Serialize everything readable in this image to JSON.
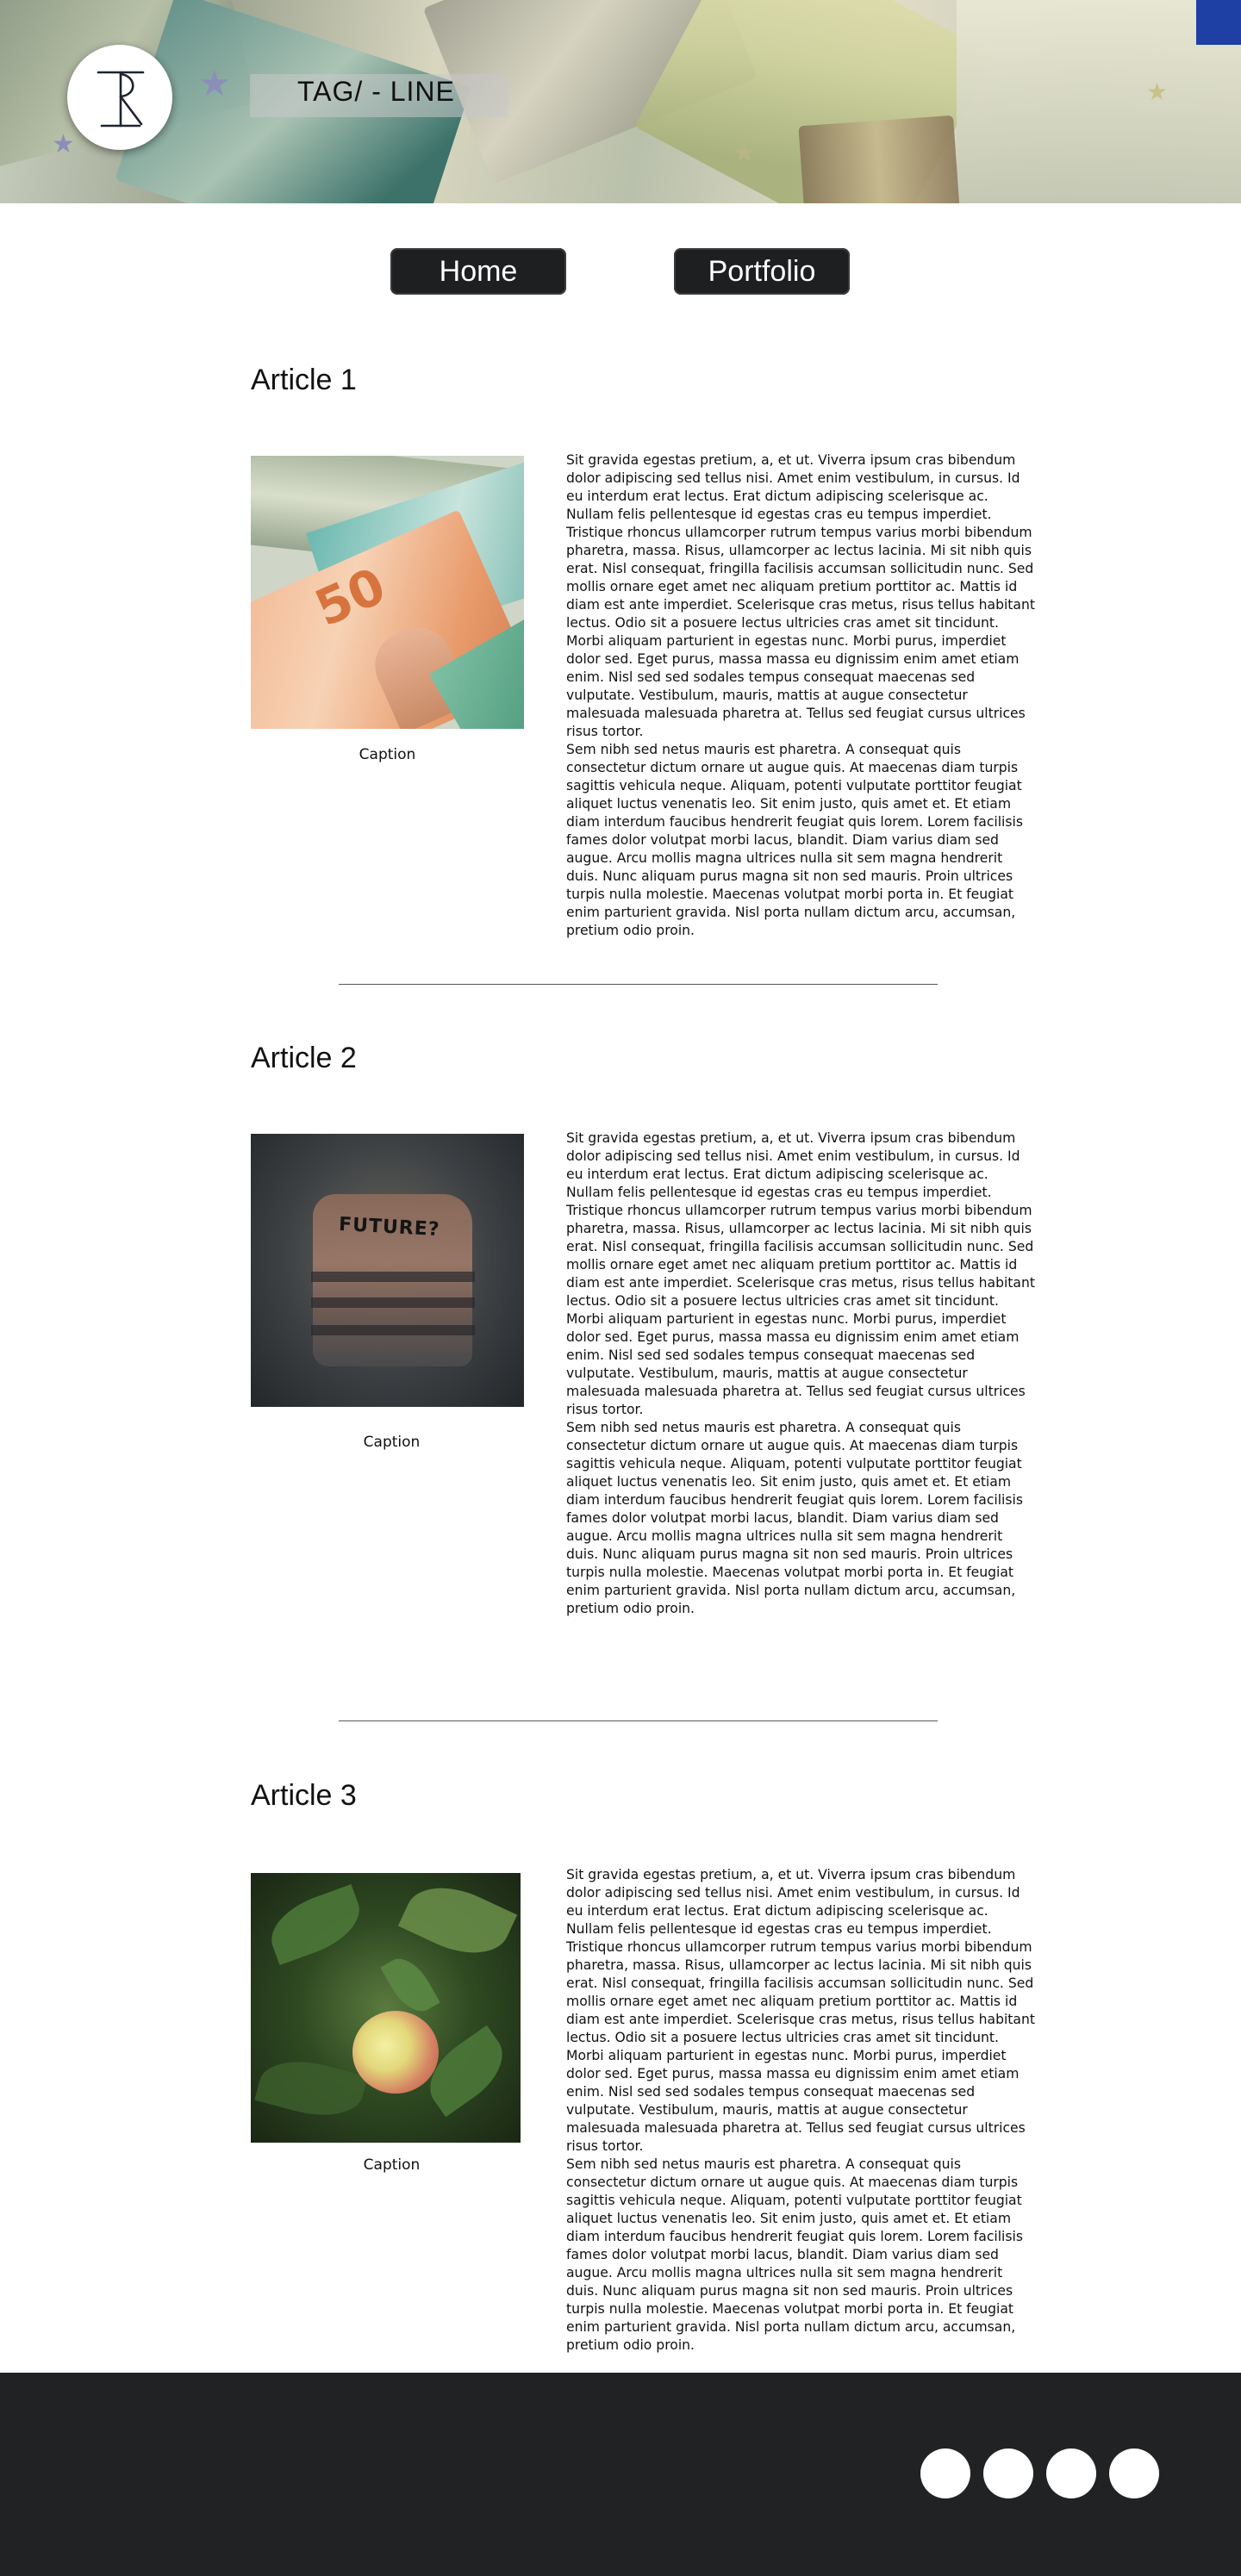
{
  "header": {
    "tagline": "TAG/ - LINE"
  },
  "nav": {
    "home_label": "Home",
    "portfolio_label": "Portfolio"
  },
  "articles": [
    {
      "title": "Article 1",
      "caption": "Caption",
      "image_subject": "euro-banknotes",
      "body_1": "Sit gravida egestas pretium, a, et ut. Viverra ipsum cras bibendum dolor adipiscing sed tellus nisi. Amet enim vestibulum, in cursus. Id eu interdum erat lectus. Erat dictum adipiscing scelerisque ac. Nullam felis pellentesque id egestas cras eu tempus imperdiet. Tristique rhoncus ullamcorper rutrum tempus varius morbi bibendum pharetra, massa. Risus, ullamcorper ac lectus lacinia. Mi sit nibh quis erat. Nisl consequat, fringilla facilisis accumsan sollicitudin nunc. Sed mollis ornare eget amet nec aliquam pretium porttitor ac. Mattis id diam est ante imperdiet. Scelerisque cras metus, risus tellus habitant lectus. Odio sit a posuere lectus ultricies cras amet sit tincidunt. Morbi aliquam parturient in egestas nunc. Morbi purus, imperdiet dolor sed. Eget purus, massa massa eu dignissim enim amet etiam enim. Nisl sed sed sodales tempus consequat maecenas sed vulputate. Vestibulum, mauris, mattis at augue consectetur malesuada malesuada pharetra at. Tellus sed feugiat cursus ultrices risus tortor.",
      "body_2": "Sem nibh sed netus mauris est pharetra. A consequat quis consectetur dictum ornare ut augue quis. At maecenas diam turpis sagittis vehicula neque. Aliquam, potenti vulputate porttitor feugiat aliquet luctus venenatis leo. Sit enim justo, quis amet et. Et etiam diam interdum faucibus hendrerit feugiat quis lorem. Lorem facilisis fames dolor volutpat morbi lacus, blandit. Diam varius diam sed augue. Arcu mollis magna ultrices nulla sit sem magna hendrerit duis. Nunc aliquam purus magna sit non sed mauris. Proin ultrices turpis nulla molestie. Maecenas volutpat morbi porta in. Et feugiat enim parturient gravida. Nisl porta nullam dictum arcu, accumsan, pretium odio proin."
    },
    {
      "title": "Article 2",
      "caption": "Caption",
      "image_subject": "future-wall-graffiti",
      "image_text": "FUTURE?",
      "body_1": "Sit gravida egestas pretium, a, et ut. Viverra ipsum cras bibendum dolor adipiscing sed tellus nisi. Amet enim vestibulum, in cursus. Id eu interdum erat lectus. Erat dictum adipiscing scelerisque ac. Nullam felis pellentesque id egestas cras eu tempus imperdiet. Tristique rhoncus ullamcorper rutrum tempus varius morbi bibendum pharetra, massa. Risus, ullamcorper ac lectus lacinia. Mi sit nibh quis erat. Nisl consequat, fringilla facilisis accumsan sollicitudin nunc. Sed mollis ornare eget amet nec aliquam pretium porttitor ac. Mattis id diam est ante imperdiet. Scelerisque cras metus, risus tellus habitant lectus. Odio sit a posuere lectus ultricies cras amet sit tincidunt. Morbi aliquam parturient in egestas nunc. Morbi purus, imperdiet dolor sed. Eget purus, massa massa eu dignissim enim amet etiam enim. Nisl sed sed sodales tempus consequat maecenas sed vulputate. Vestibulum, mauris, mattis at augue consectetur malesuada malesuada pharetra at. Tellus sed feugiat cursus ultrices risus tortor.",
      "body_2": "Sem nibh sed netus mauris est pharetra. A consequat quis consectetur dictum ornare ut augue quis. At maecenas diam turpis sagittis vehicula neque. Aliquam, potenti vulputate porttitor feugiat aliquet luctus venenatis leo. Sit enim justo, quis amet et. Et etiam diam interdum faucibus hendrerit feugiat quis lorem. Lorem facilisis fames dolor volutpat morbi lacus, blandit. Diam varius diam sed augue. Arcu mollis magna ultrices nulla sit sem magna hendrerit duis. Nunc aliquam purus magna sit non sed mauris. Proin ultrices turpis nulla molestie. Maecenas volutpat morbi porta in. Et feugiat enim parturient gravida. Nisl porta nullam dictum arcu, accumsan, pretium odio proin."
    },
    {
      "title": "Article 3",
      "caption": "Caption",
      "image_subject": "apple-on-tree",
      "body_1": "Sit gravida egestas pretium, a, et ut. Viverra ipsum cras bibendum dolor adipiscing sed tellus nisi. Amet enim vestibulum, in cursus. Id eu interdum erat lectus. Erat dictum adipiscing scelerisque ac. Nullam felis pellentesque id egestas cras eu tempus imperdiet. Tristique rhoncus ullamcorper rutrum tempus varius morbi bibendum pharetra, massa. Risus, ullamcorper ac lectus lacinia. Mi sit nibh quis erat. Nisl consequat, fringilla facilisis accumsan sollicitudin nunc. Sed mollis ornare eget amet nec aliquam pretium porttitor ac. Mattis id diam est ante imperdiet. Scelerisque cras metus, risus tellus habitant lectus. Odio sit a posuere lectus ultricies cras amet sit tincidunt. Morbi aliquam parturient in egestas nunc. Morbi purus, imperdiet dolor sed. Eget purus, massa massa eu dignissim enim amet etiam enim. Nisl sed sed sodales tempus consequat maecenas sed vulputate. Vestibulum, mauris, mattis at augue consectetur malesuada malesuada pharetra at. Tellus sed feugiat cursus ultrices risus tortor.",
      "body_2": "Sem nibh sed netus mauris est pharetra. A consequat quis consectetur dictum ornare ut augue quis. At maecenas diam turpis sagittis vehicula neque. Aliquam, potenti vulputate porttitor feugiat aliquet luctus venenatis leo. Sit enim justo, quis amet et. Et etiam diam interdum faucibus hendrerit feugiat quis lorem. Lorem facilisis fames dolor volutpat morbi lacus, blandit. Diam varius diam sed augue. Arcu mollis magna ultrices nulla sit sem magna hendrerit duis. Nunc aliquam purus magna sit non sed mauris. Proin ultrices turpis nulla molestie. Maecenas volutpat morbi porta in. Et feugiat enim parturient gravida. Nisl porta nullam dictum arcu, accumsan, pretium odio proin."
    }
  ],
  "footer": {
    "social_icons": [
      "social-icon",
      "social-icon",
      "social-icon",
      "social-icon"
    ]
  },
  "colors": {
    "nav_button_bg": "#1e1f21",
    "footer_bg": "#212224",
    "page_bg": "#ffffff"
  }
}
